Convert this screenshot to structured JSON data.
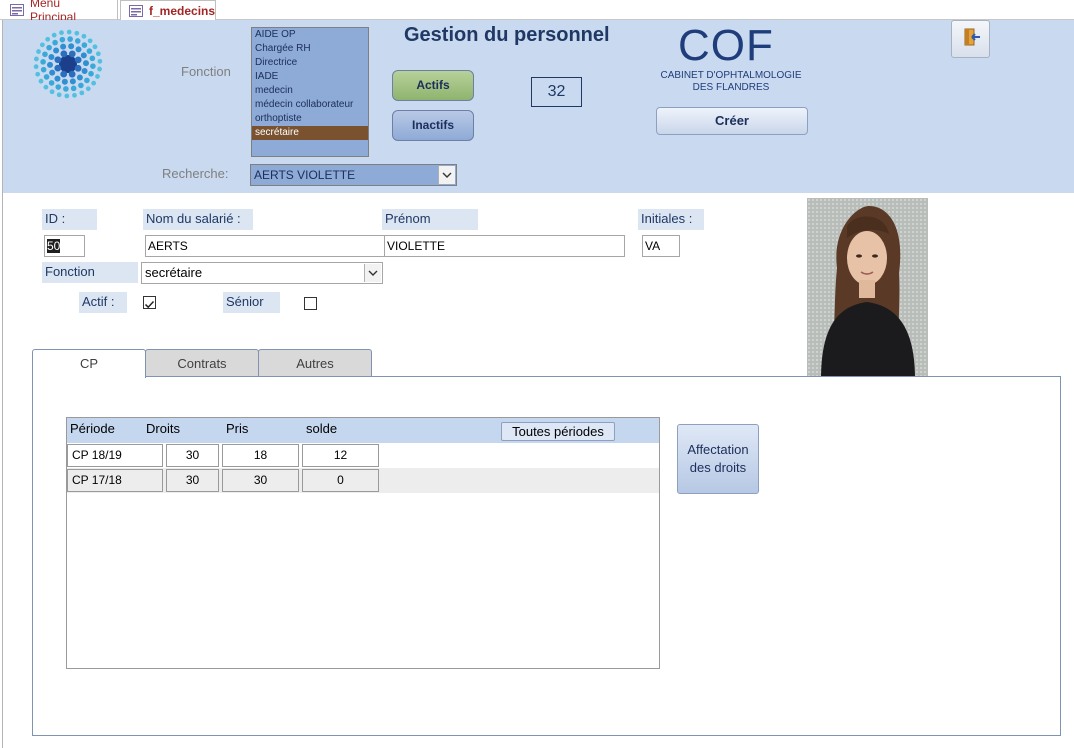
{
  "tabs": [
    {
      "label": "Menu Principal"
    },
    {
      "label": "f_medecins"
    }
  ],
  "header": {
    "title": "Gestion du personnel",
    "fonction_label": "Fonction",
    "fonction_options": [
      "AIDE OP",
      "Chargée RH",
      "Directrice",
      "IADE",
      "medecin",
      "médecin collaborateur",
      "orthoptiste",
      "secrétaire"
    ],
    "fonction_selected": "secrétaire",
    "actifs_label": "Actifs",
    "inactifs_label": "Inactifs",
    "count": "32",
    "brand": {
      "logo_text": "COF",
      "line1": "CABINET D'OPHTALMOLOGIE",
      "line2": "DES FLANDRES"
    },
    "creer_label": "Créer",
    "recherche_label": "Recherche:",
    "recherche_value": "AERTS VIOLETTE"
  },
  "form": {
    "id_label": "ID :",
    "id_value": "50",
    "nom_label": "Nom du salarié :",
    "nom_value": "AERTS",
    "prenom_label": "Prénom",
    "prenom_value": "VIOLETTE",
    "initiales_label": "Initiales :",
    "initiales_value": "VA",
    "fonction_label": "Fonction",
    "fonction_value": "secrétaire",
    "actif_label": "Actif :",
    "actif_checked": true,
    "senior_label": "Sénior",
    "senior_checked": false
  },
  "tabcontrol": {
    "tabs": [
      "CP",
      "Contrats",
      "Autres"
    ],
    "active": "CP"
  },
  "cp": {
    "columns": [
      "Période",
      "Droits",
      "Pris",
      "solde"
    ],
    "toutes_label": "Toutes périodes",
    "rows": [
      {
        "periode": "CP 18/19",
        "droits": "30",
        "pris": "18",
        "solde": "12"
      },
      {
        "periode": "CP 17/18",
        "droits": "30",
        "pris": "30",
        "solde": "0"
      }
    ],
    "affectation_line1": "Affectation",
    "affectation_line2": "des droits"
  },
  "colors": {
    "header_bg": "#c9daf0",
    "brand_blue": "#1f3d7a",
    "listbox_bg": "#8eaad6",
    "selected_item": "#7a5230",
    "actifs_green": "#9fbf7d",
    "tab_text_red": "#a32626"
  },
  "icons": {
    "form_tab": "form-icon",
    "exit": "exit-door-icon",
    "dropdown": "chevron-down-icon",
    "check": "checkmark-icon"
  }
}
